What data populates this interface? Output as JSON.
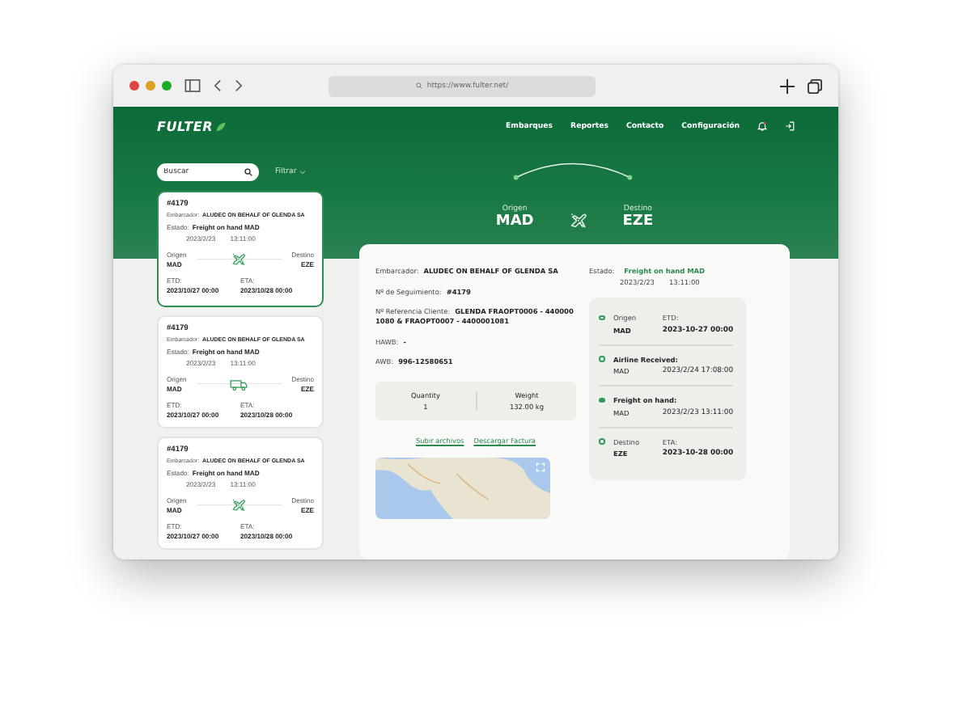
{
  "browser": {
    "url": "https://www.fulter.net/"
  },
  "header": {
    "logo": "FULTER",
    "nav": [
      "Embarques",
      "Reportes",
      "Contacto",
      "Configuración"
    ]
  },
  "search": {
    "placeholder": "Buscar",
    "filter": "Filtrar"
  },
  "shipments": [
    {
      "id": "#4179",
      "selected": true,
      "kind": "air",
      "shipper_label": "Embarcador:",
      "shipper": "ALUDEC ON BEHALF OF GLENDA SA",
      "status_label": "Estado:",
      "status": "Freight on hand MAD",
      "date": "2023/2/23",
      "time": "13:11:00",
      "origin_label": "Origen",
      "origin": "MAD",
      "destination_label": "Destino",
      "destination": "EZE",
      "etd_label": "ETD:",
      "etd": "2023/10/27 00:00",
      "eta_label": "ETA:",
      "eta": "2023/10/28 00:00"
    },
    {
      "id": "#4179",
      "selected": false,
      "kind": "road",
      "shipper_label": "Embarcador:",
      "shipper": "ALUDEC ON BEHALF OF GLENDA SA",
      "status_label": "Estado:",
      "status": "Freight on hand MAD",
      "date": "2023/2/23",
      "time": "13:11:00",
      "origin_label": "Origen",
      "origin": "MAD",
      "destination_label": "Destino",
      "destination": "EZE",
      "etd_label": "ETD:",
      "etd": "2023/10/27 00:00",
      "eta_label": "ETA:",
      "eta": "2023/10/28 00:00"
    },
    {
      "id": "#4179",
      "selected": false,
      "kind": "air",
      "shipper_label": "Embarcador:",
      "shipper": "ALUDEC ON BEHALF OF GLENDA SA",
      "status_label": "Estado:",
      "status": "Freight on hand MAD",
      "date": "2023/2/23",
      "time": "13:11:00",
      "origin_label": "Origen",
      "origin": "MAD",
      "destination_label": "Destino",
      "destination": "EZE",
      "etd_label": "ETD:",
      "etd": "2023/10/27 00:00",
      "eta_label": "ETA:",
      "eta": "2023/10/28 00:00"
    }
  ],
  "route": {
    "origin_label": "Origen",
    "origin": "MAD",
    "destination_label": "Destino",
    "destination": "EZE"
  },
  "detail": {
    "fields": [
      {
        "label": "Embarcador:",
        "value": "ALUDEC ON BEHALF OF GLENDA SA"
      },
      {
        "label": "Nº de Seguimiento:",
        "value": "#4179"
      },
      {
        "label": "Nº Referencia Cliente:",
        "value": "GLENDA FRAOPT0006 - 440000 1080 & FRAOPT0007 - 4400001081"
      },
      {
        "label": "HAWB:",
        "value": "-"
      },
      {
        "label": "AWB:",
        "value": "996-12580651"
      }
    ],
    "stats": [
      {
        "label": "Quantity",
        "value": "1"
      },
      {
        "label": "Weight",
        "value": "132.00 kg"
      }
    ],
    "links": [
      "Subir archivos",
      "Descargar Factura"
    ]
  },
  "status": {
    "label": "Estado:",
    "value": "Freight on hand MAD",
    "date": "2023/2/23",
    "time": "13:11:00"
  },
  "timeline": [
    {
      "kind": "endpoint",
      "current": false,
      "label": "Origen",
      "place": "MAD",
      "date_label": "ETD:",
      "date": "2023-10-27 00:00"
    },
    {
      "kind": "event",
      "current": false,
      "label": "Airline Received:",
      "place": "MAD",
      "date": "2023/2/24 17:08:00"
    },
    {
      "kind": "event",
      "current": true,
      "label": "Freight on hand:",
      "place": "MAD",
      "date": "2023/2/23 13:11:00"
    },
    {
      "kind": "endpoint",
      "current": false,
      "label": "Destino",
      "place": "EZE",
      "date_label": "ETA:",
      "date": "2023-10-28 00:00"
    }
  ]
}
